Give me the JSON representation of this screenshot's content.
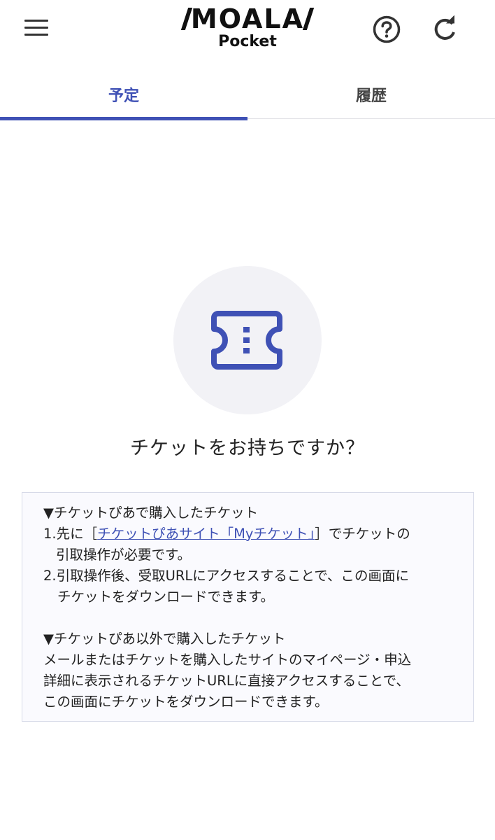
{
  "header": {
    "logo_main": "MOALA",
    "logo_sub": "Pocket",
    "menu_icon": "hamburger-menu-icon",
    "help_icon": "help-circle-icon",
    "refresh_icon": "refresh-icon"
  },
  "tabs": [
    {
      "label": "予定",
      "active": true
    },
    {
      "label": "履歴",
      "active": false
    }
  ],
  "empty_state": {
    "icon": "ticket-icon",
    "question": "チケットをお持ちですか？"
  },
  "info": {
    "section1_heading": "▼チケットぴあで購入したチケット",
    "step1_prefix": "1.先に［",
    "step1_link": "チケットぴあサイト「Myチケット」",
    "step1_suffix": "］でチケットの",
    "step1_line2": "引取操作が必要です。",
    "step2_line1": "2.引取操作後、受取URLにアクセスすることで、この画面に",
    "step2_line2": "チケットをダウンロードできます。",
    "section2_heading": "▼チケットぴあ以外で購入したチケット",
    "section2_line1": "メールまたはチケットを購入したサイトのマイページ・申込",
    "section2_line2": "詳細に表示されるチケットURLに直接アクセスすることで、",
    "section2_line3": "この画面にチケットをダウンロードできます。"
  },
  "colors": {
    "accent": "#3f51b5",
    "circle_bg": "#f2f2f6",
    "box_border": "#d7dae8"
  }
}
